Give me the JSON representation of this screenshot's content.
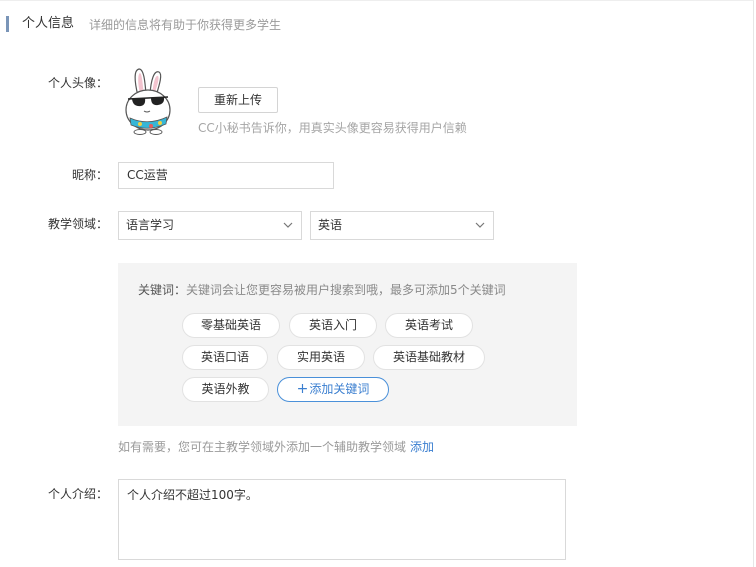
{
  "header": {
    "title": "个人信息",
    "subtitle": "详细的信息将有助于你获得更多学生"
  },
  "avatar_section": {
    "label": "个人头像：",
    "reupload_button": "重新上传",
    "hint": "CC小秘书告诉你，用真实头像更容易获得用户信赖",
    "icon": "bunny-avatar-icon"
  },
  "nickname": {
    "label": "昵称：",
    "value": "CC运营"
  },
  "teaching_domain": {
    "label": "教学领域：",
    "primary": "语言学习",
    "secondary": "英语"
  },
  "keywords": {
    "title_prefix": "关键词：",
    "title_text": "关键词会让您更容易被用户搜索到哦，最多可添加5个关键词",
    "tags": [
      "零基础英语",
      "英语入门",
      "英语考试",
      "英语口语",
      "实用英语",
      "英语基础教材",
      "英语外教"
    ],
    "add_button": "添加关键词",
    "add_symbol": "+"
  },
  "assist_domain": {
    "hint": "如有需要，您可在主教学领域外添加一个辅助教学领域",
    "link": "添加"
  },
  "intro": {
    "label": "个人介绍：",
    "value": "个人介绍不超过100字。"
  },
  "colors": {
    "accent_bar": "#7a95b8",
    "link_blue": "#3b7fd0",
    "panel_bg": "#f4f4f4"
  }
}
